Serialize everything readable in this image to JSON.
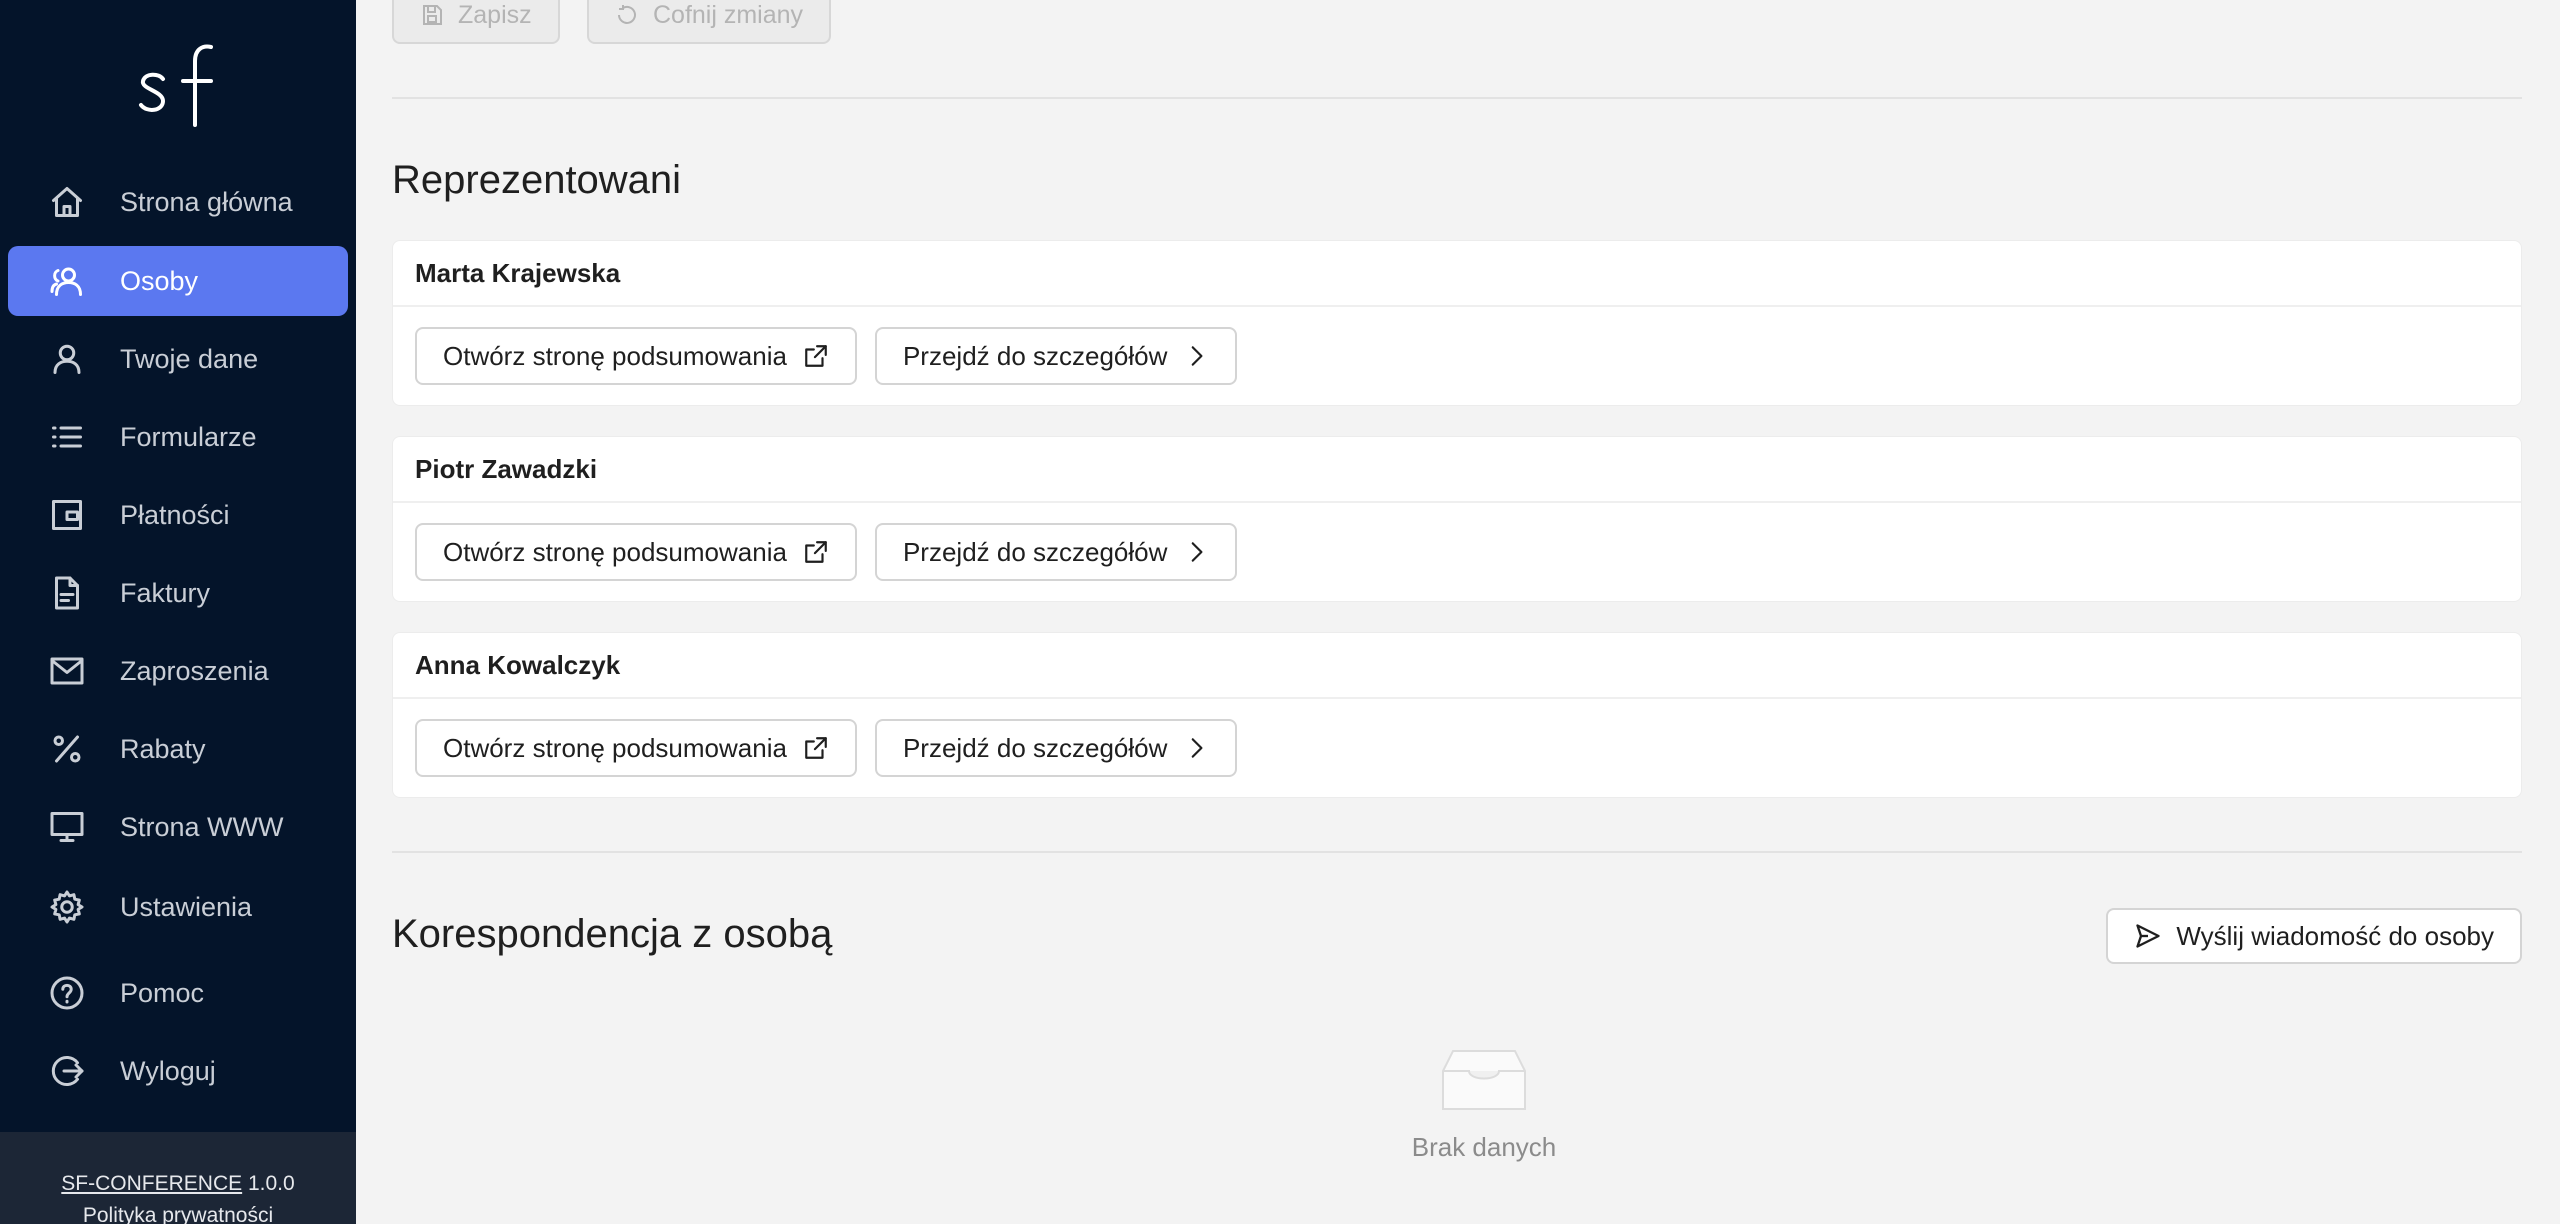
{
  "sidebar": {
    "logo_text": "sf",
    "items": [
      {
        "label": "Strona główna",
        "icon": "home-icon"
      },
      {
        "label": "Osoby",
        "icon": "users-icon",
        "active": true
      },
      {
        "label": "Twoje dane",
        "icon": "user-icon"
      },
      {
        "label": "Formularze",
        "icon": "list-icon"
      },
      {
        "label": "Płatności",
        "icon": "wallet-icon"
      },
      {
        "label": "Faktury",
        "icon": "file-icon"
      },
      {
        "label": "Zaproszenia",
        "icon": "mail-icon"
      },
      {
        "label": "Rabaty",
        "icon": "percent-icon"
      },
      {
        "label": "Strona WWW",
        "icon": "monitor-icon"
      },
      {
        "label": "Ustawienia",
        "icon": "gear-icon"
      },
      {
        "label": "Pomoc",
        "icon": "help-icon"
      },
      {
        "label": "Wyloguj",
        "icon": "logout-icon"
      }
    ],
    "footer": {
      "app_name": "SF-CONFERENCE",
      "version": "1.0.0",
      "privacy": "Polityka prywatności"
    }
  },
  "toolbar": {
    "save_label": "Zapisz",
    "revert_label": "Cofnij zmiany"
  },
  "represented": {
    "title": "Reprezentowani",
    "open_summary_label": "Otwórz stronę podsumowania",
    "details_label": "Przejdź do szczegółów",
    "people": [
      {
        "name": "Marta Krajewska"
      },
      {
        "name": "Piotr Zawadzki"
      },
      {
        "name": "Anna Kowalczyk"
      }
    ]
  },
  "correspondence": {
    "title": "Korespondencja z osobą",
    "send_label": "Wyślij wiadomość do osoby",
    "empty_text": "Brak danych"
  }
}
